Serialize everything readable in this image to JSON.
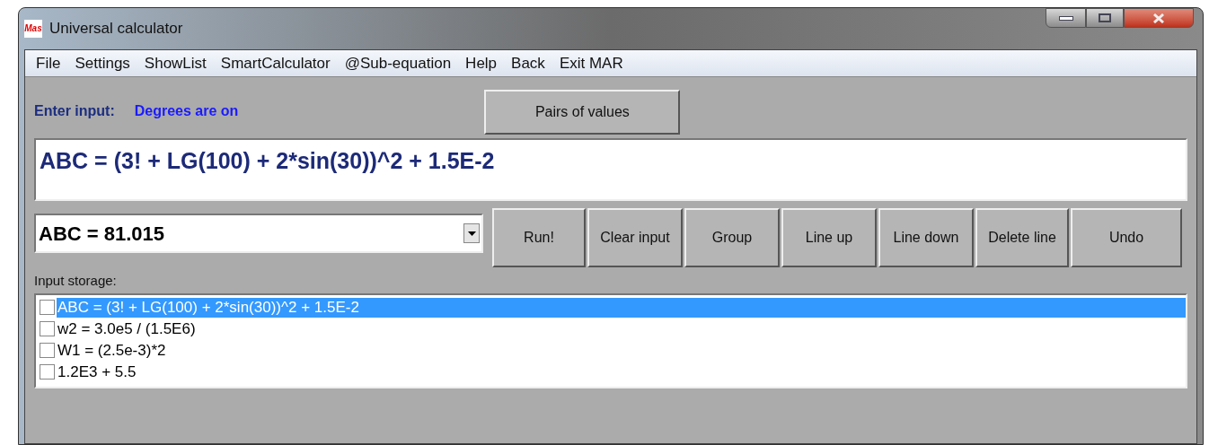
{
  "window": {
    "title": "Universal calculator",
    "logo": "Mas"
  },
  "menu": [
    "File",
    "Settings",
    "ShowList",
    "SmartCalculator",
    "@Sub-equation",
    "Help",
    "Back",
    "Exit MAR"
  ],
  "input_label": "Enter input:",
  "degrees_status": "Degrees are on",
  "pairs_button": "Pairs of values",
  "input": {
    "value": "ABC = (3! + LG(100) + 2*sin(30))^2 + 1.5E-2"
  },
  "result": {
    "value": "ABC = 81.015"
  },
  "buttons": [
    "Run!",
    "Clear input",
    "Group",
    "Line up",
    "Line down",
    "Delete line",
    "Undo"
  ],
  "storage": {
    "label": "Input storage:",
    "items": [
      {
        "text": "ABC = (3! + LG(100) + 2*sin(30))^2 + 1.5E-2",
        "checked": false,
        "selected": true
      },
      {
        "text": "w2 = 3.0e5 / (1.5E6)",
        "checked": false,
        "selected": false
      },
      {
        "text": "W1 = (2.5e-3)*2",
        "checked": false,
        "selected": false
      },
      {
        "text": "1.2E3 + 5.5",
        "checked": false,
        "selected": false
      }
    ]
  }
}
